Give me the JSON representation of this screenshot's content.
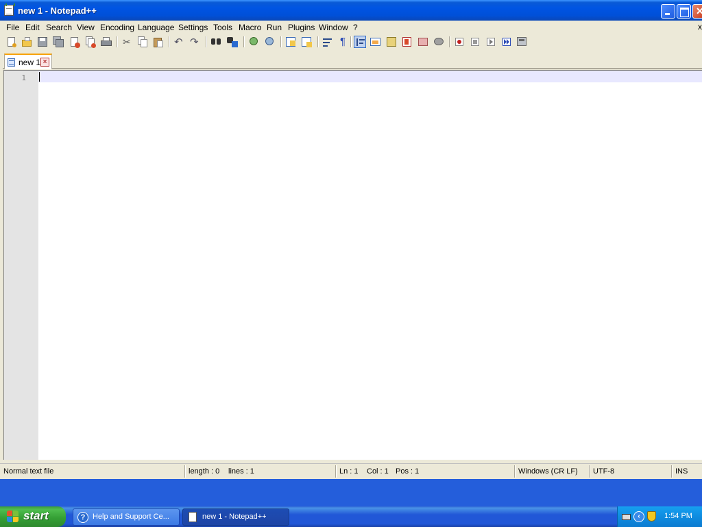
{
  "window": {
    "title": "new 1 - Notepad++"
  },
  "menu": {
    "items": [
      "File",
      "Edit",
      "Search",
      "View",
      "Encoding",
      "Language",
      "Settings",
      "Tools",
      "Macro",
      "Run",
      "Plugins",
      "Window",
      "?"
    ],
    "close_doc": "x"
  },
  "toolbar": {
    "icons": [
      "new-file-icon",
      "open-file-icon",
      "save-icon",
      "save-all-icon",
      "close-icon",
      "close-all-icon",
      "print-icon",
      "cut-icon",
      "copy-icon",
      "paste-icon",
      "undo-icon",
      "redo-icon",
      "find-icon",
      "replace-icon",
      "zoom-in-icon",
      "zoom-out-icon",
      "sync-vertical-icon",
      "sync-horizontal-icon",
      "word-wrap-icon",
      "show-all-chars-icon",
      "indent-guide-icon",
      "user-language-icon",
      "function-list-icon",
      "document-map-icon",
      "folder-workspace-icon",
      "monitoring-icon",
      "record-macro-icon",
      "stop-macro-icon",
      "play-macro-icon",
      "run-macro-multiple-icon",
      "save-macro-icon"
    ],
    "selected": "indent-guide-icon"
  },
  "tabs": [
    {
      "label": "new 1",
      "active": true
    }
  ],
  "editor": {
    "lines": [
      "1"
    ],
    "content": ""
  },
  "status": {
    "file_type": "Normal text file",
    "length": "length : 0",
    "lines": "lines : 1",
    "ln": "Ln : 1",
    "col": "Col : 1",
    "pos": "Pos : 1",
    "eol": "Windows (CR LF)",
    "encoding": "UTF-8",
    "mode": "INS"
  },
  "taskbar": {
    "start_label": "start",
    "buttons": [
      {
        "label": "Help and Support Ce...",
        "icon": "help-icon"
      },
      {
        "label": "new 1 - Notepad++",
        "icon": "notepad-plus-plus-icon"
      }
    ],
    "clock": "1:54 PM"
  },
  "colors": {
    "titlebar": "#0054e3",
    "window_bg": "#ece9d8",
    "current_line": "#e8e8ff",
    "gutter": "#e4e4e4",
    "start_button": "#35a035",
    "tab_accent": "#f7a20a"
  }
}
